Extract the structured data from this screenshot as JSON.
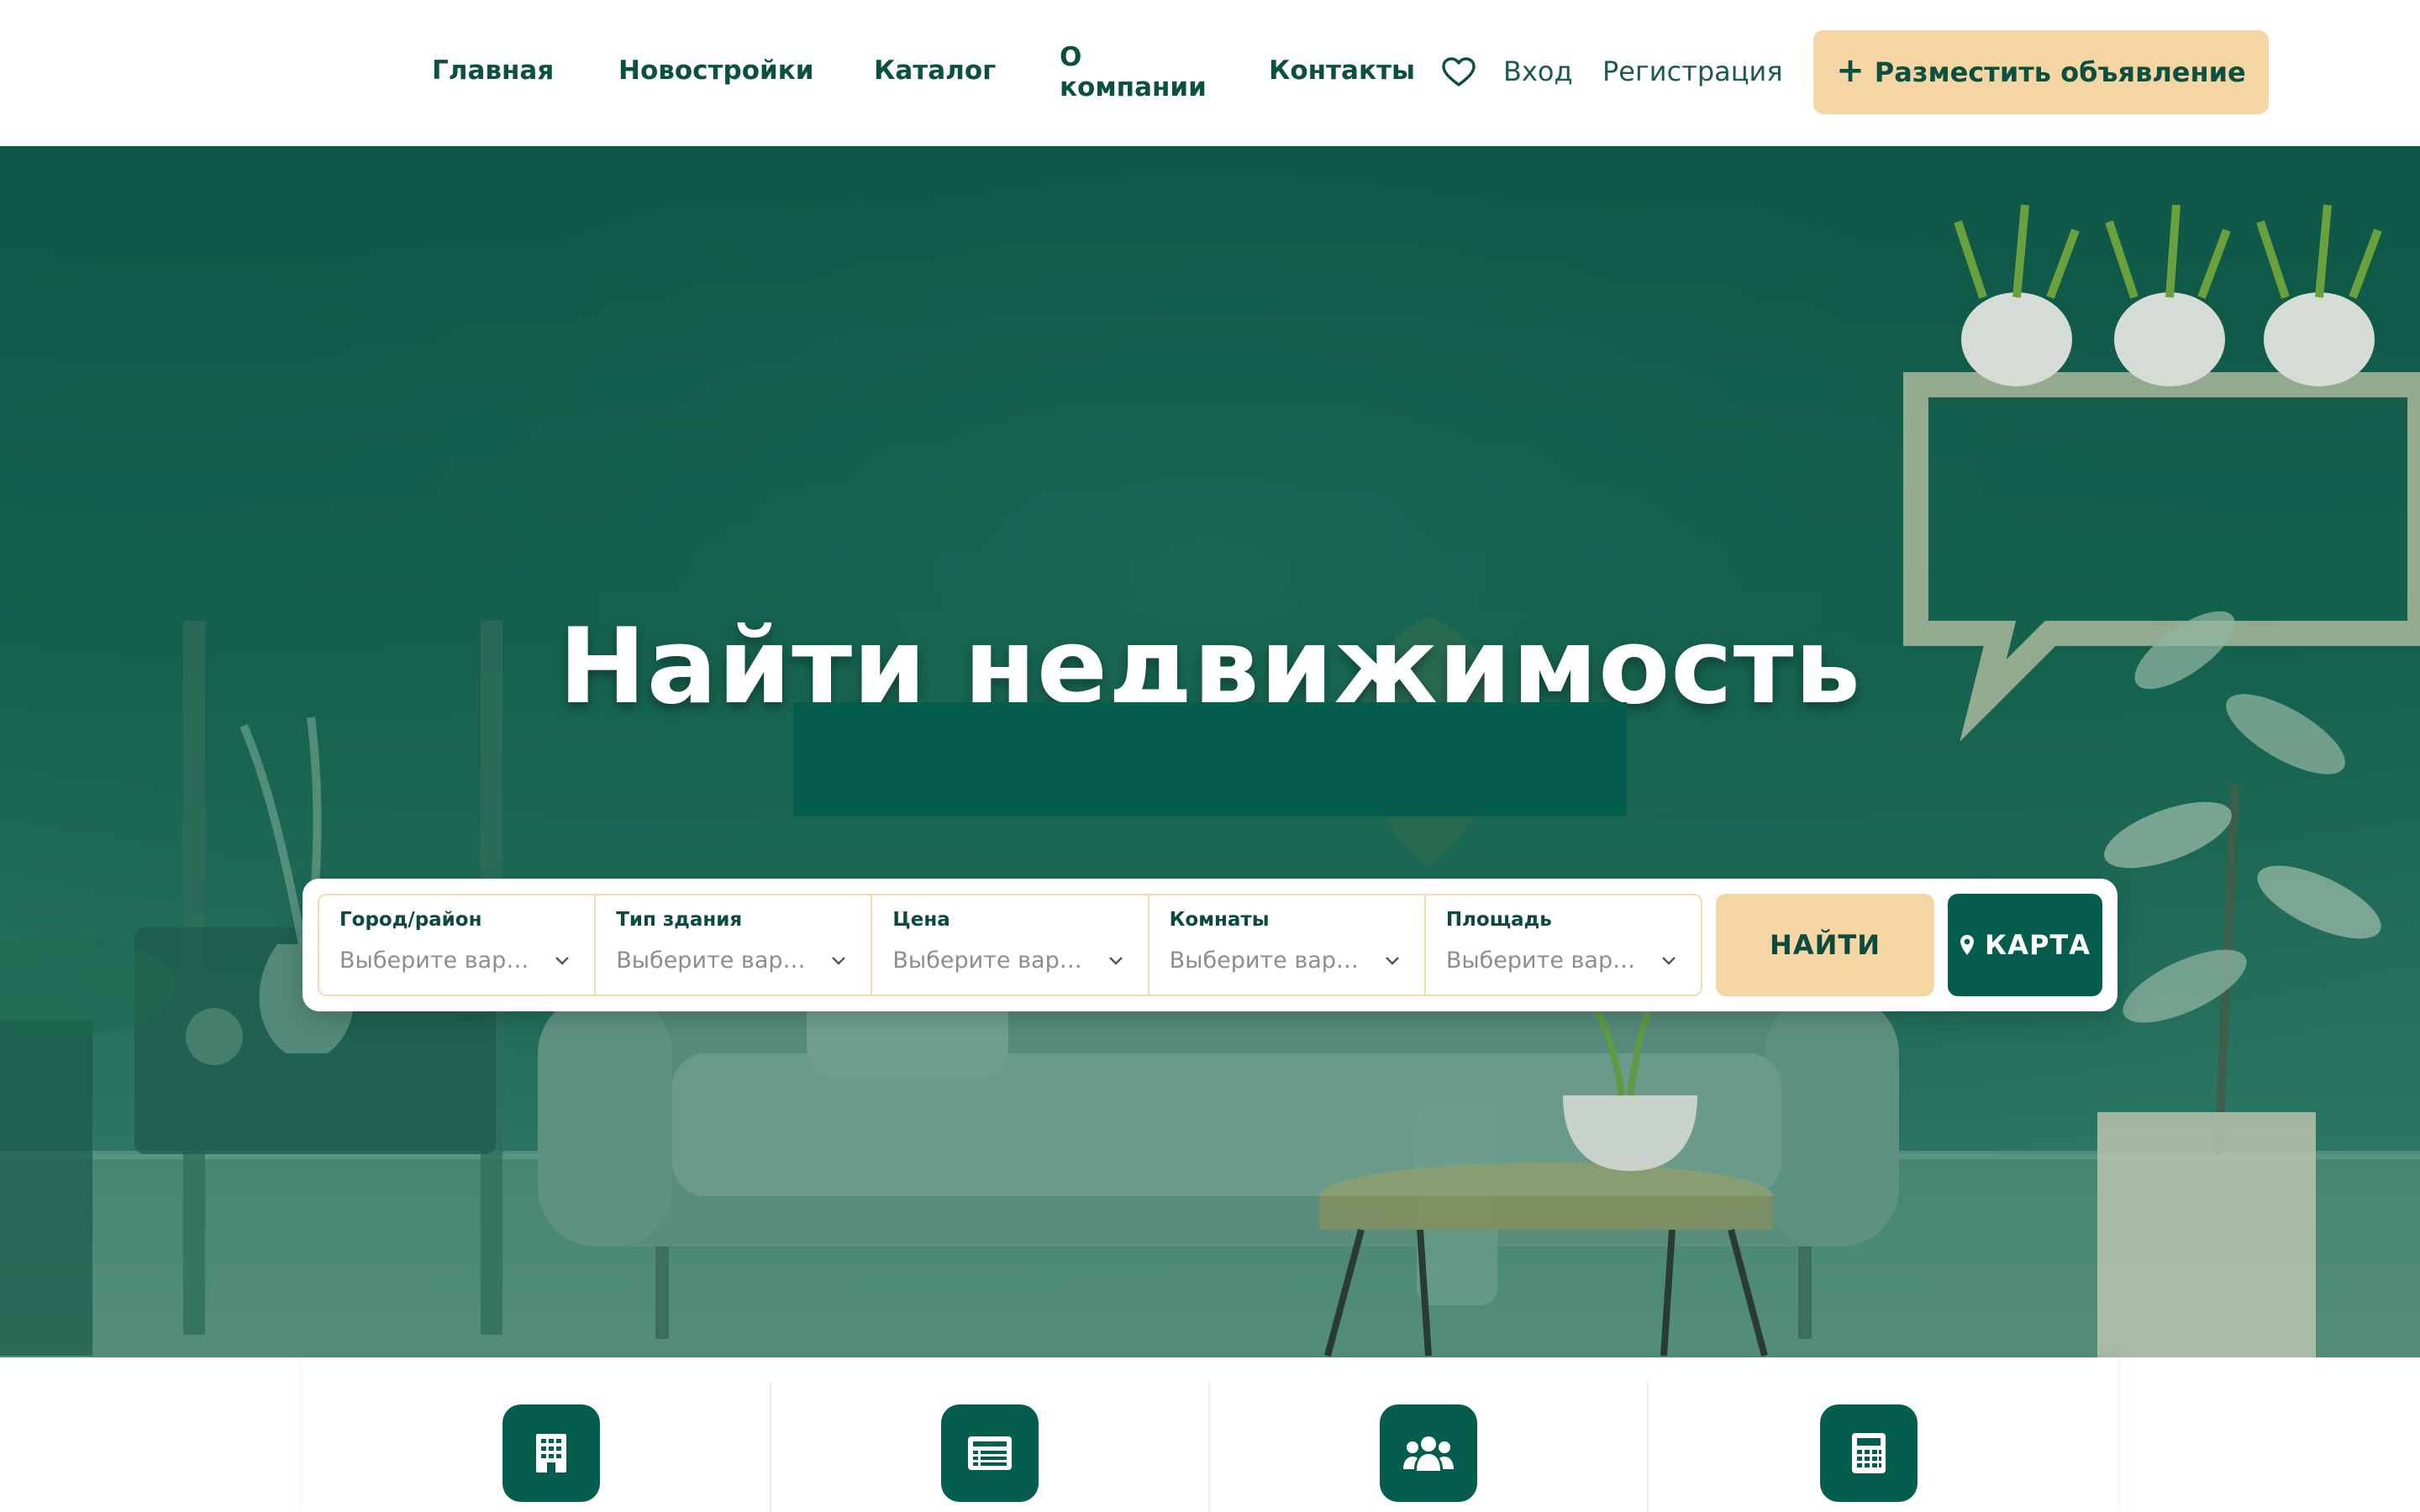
{
  "nav": {
    "home": "Главная",
    "new_buildings": "Новостройки",
    "catalog": "Каталог",
    "about": "О компании",
    "contacts": "Контакты"
  },
  "auth": {
    "login": "Вход",
    "register": "Регистрация"
  },
  "post_ad": {
    "icon": "plus-icon",
    "label": "Разместить объявление"
  },
  "hero": {
    "title": "Найти недвижимость"
  },
  "search": {
    "filters": [
      {
        "label": "Город/район",
        "value": "Выберите вари…"
      },
      {
        "label": "Тип здания",
        "value": "Выберите вари…"
      },
      {
        "label": "Цена",
        "value": "Выберите вари…"
      },
      {
        "label": "Комнаты",
        "value": "Выберите вари…"
      },
      {
        "label": "Площадь",
        "value": "Выберите вариа…"
      }
    ],
    "find_label": "НАЙТИ",
    "map_label": "КАРТА"
  },
  "features": {
    "icons": [
      "building-icon",
      "list-icon",
      "users-icon",
      "calculator-icon"
    ]
  },
  "colors": {
    "brand": "#055d4e",
    "text_dark": "#0b5140",
    "accent": "#f5d5a4",
    "filter_border": "#f3dcb3"
  }
}
